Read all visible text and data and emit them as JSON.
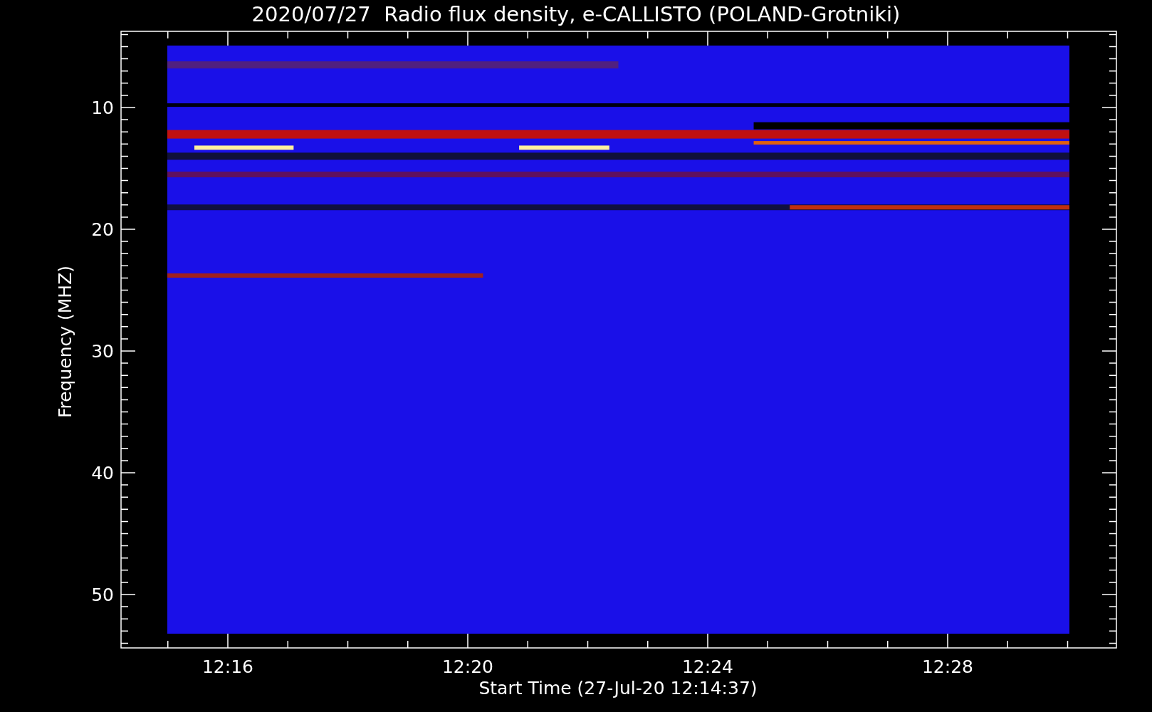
{
  "title": "2020/07/27  Radio flux density, e-CALLISTO (POLAND-Grotniki)",
  "xlabel": "Start Time (27-Jul-20 12:14:37)",
  "ylabel": "Frequency (MHZ)",
  "xticks": [
    "12:16",
    "12:20",
    "12:24",
    "12:28"
  ],
  "yticks": [
    "10",
    "20",
    "30",
    "40",
    "50"
  ]
}
